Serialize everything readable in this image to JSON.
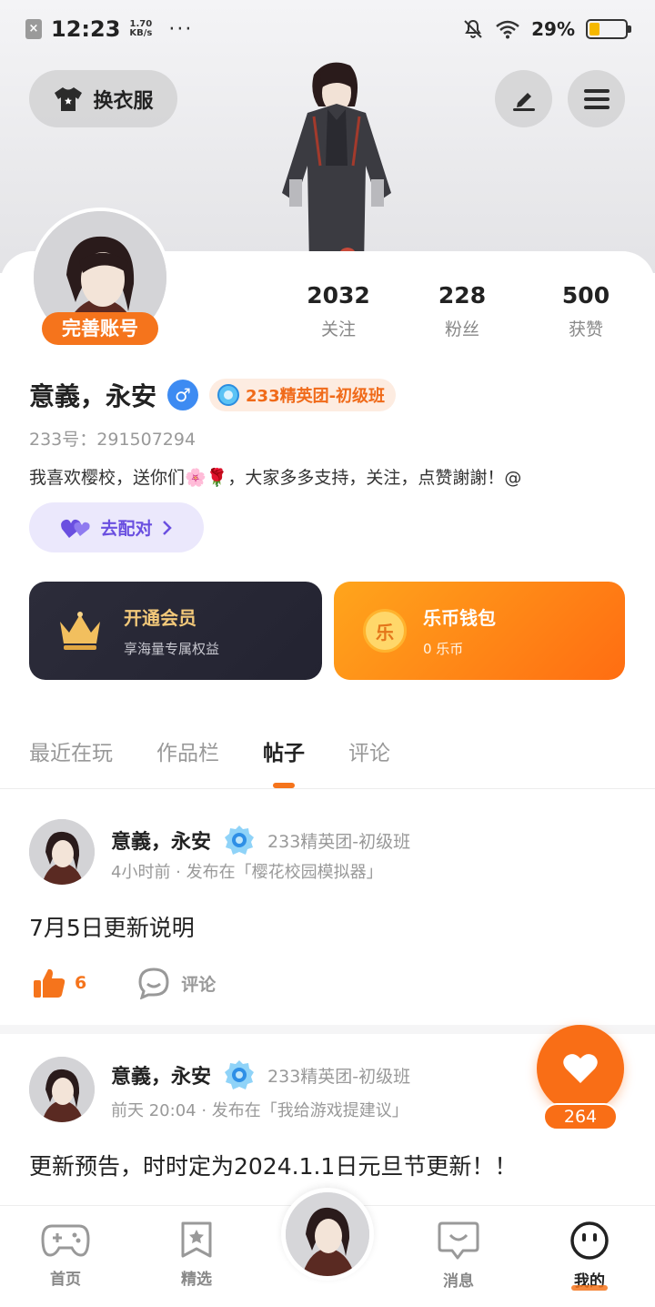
{
  "status_bar": {
    "time": "12:23",
    "net_speed_value": "1.70",
    "net_speed_unit": "KB/s",
    "more": "···",
    "battery_percent": "29%",
    "battery_level": 0.29
  },
  "header": {
    "outfit_label": "换衣服"
  },
  "profile": {
    "complete_account_label": "完善账号",
    "stats": [
      {
        "value": "2032",
        "label": "关注"
      },
      {
        "value": "228",
        "label": "粉丝"
      },
      {
        "value": "500",
        "label": "获赞"
      }
    ],
    "username": "意義，永安",
    "gender_symbol": "♂",
    "rank_badge": "233精英团-初级班",
    "user_id": "233号：291507294",
    "bio": "我喜欢樱校，送你们🌸🌹，大家多多支持，关注，点赞謝謝！@",
    "pair_label": "去配对"
  },
  "cards": {
    "vip": {
      "title": "开通会员",
      "subtitle": "享海量专属权益"
    },
    "wallet": {
      "title": "乐币钱包",
      "subtitle": "0 乐币",
      "coin_glyph": "乐"
    }
  },
  "tabs": [
    "最近在玩",
    "作品栏",
    "帖子",
    "评论"
  ],
  "active_tab": 2,
  "posts": [
    {
      "author": "意義，永安",
      "rank": "233精英团-初级班",
      "meta": "4小时前 · 发布在「樱花校园模拟器」",
      "title": "7月5日更新说明",
      "likes": "6",
      "comment_label": "评论"
    },
    {
      "author": "意義，永安",
      "rank": "233精英团-初级班",
      "meta": "前天 20:04 · 发布在「我给游戏提建议」",
      "title": "更新预告，时时定为2024.1.1日元旦节更新！！"
    }
  ],
  "fab": {
    "count": "264"
  },
  "bottom_nav": [
    {
      "label": "首页",
      "icon": "gamepad-icon"
    },
    {
      "label": "精选",
      "icon": "star-bookmark-icon"
    },
    {
      "label": "消息",
      "icon": "message-icon"
    },
    {
      "label": "我的",
      "icon": "smiley-icon"
    }
  ],
  "colors": {
    "accent": "#f5741c",
    "vip_bg": "#2a2a37",
    "wallet_gradient": [
      "#ffa51c",
      "#ff6d12"
    ],
    "pair_bg": "#ebe8fc",
    "gender": "#3d8bf2"
  }
}
